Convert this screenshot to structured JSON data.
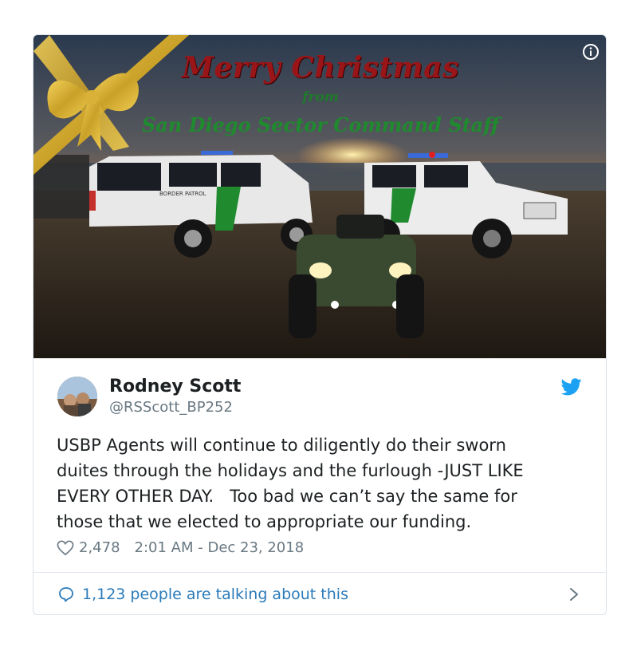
{
  "greeting": {
    "title": "Merry Christmas",
    "from": "from",
    "staff": "San Diego Sector Command Staff"
  },
  "vehicle_labels": {
    "suv_door": "BORDER PATROL"
  },
  "author": {
    "name": "Rodney Scott",
    "handle": "@RSScott_BP252"
  },
  "tweet": {
    "text": "USBP Agents will continue to diligently do their sworn\nduites through the holidays and the furlough -JUST LIKE\nEVERY OTHER DAY.   Too bad we can’t say the same for\nthose that we elected to appropriate our funding.",
    "likes": "2,478",
    "timestamp": "2:01 AM - Dec 23, 2018"
  },
  "footer": {
    "talking": "1,123 people are talking about this"
  },
  "icons": {
    "info": "info-icon",
    "bird": "twitter-bird-icon",
    "heart": "heart-icon",
    "reply": "speech-bubble-icon",
    "chevron": "chevron-right-icon"
  },
  "colors": {
    "twitter_blue": "#1da1f2",
    "link_blue": "#2b7bb9",
    "muted": "#697882",
    "title_red": "#9a1518",
    "greeting_green": "#1f8a2e"
  }
}
